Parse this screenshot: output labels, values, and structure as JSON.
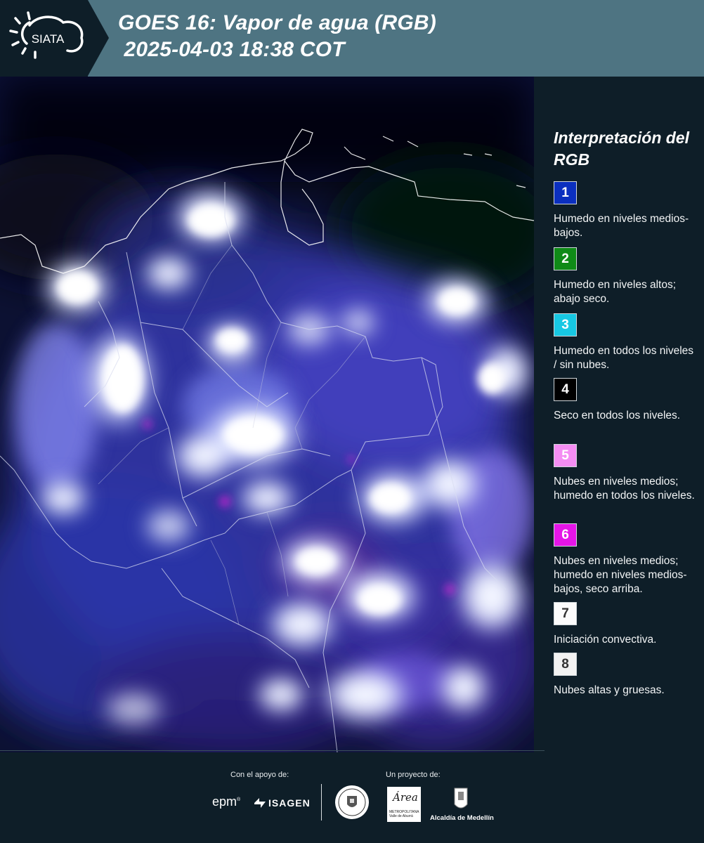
{
  "header": {
    "logo_text": "SIATA",
    "title_line1": "GOES 16: Vapor de agua (RGB)",
    "title_line2": " 2025-04-03 18:38 COT"
  },
  "legend": {
    "title": "Interpretación del RGB",
    "items": [
      {
        "number": "1",
        "color": "#0b2fbf",
        "text_color": "#ffffff",
        "text": "Humedo en niveles medios-bajos."
      },
      {
        "number": "2",
        "color": "#0f8a17",
        "text_color": "#ffffff",
        "text": "Humedo en niveles altos; abajo seco."
      },
      {
        "number": "3",
        "color": "#17c8e3",
        "text_color": "#ffffff",
        "text": "Humedo en todos los niveles / sin nubes."
      },
      {
        "number": "4",
        "color": "#000000",
        "text_color": "#ffffff",
        "text": "Seco en todos los niveles."
      },
      {
        "number": "5",
        "color": "#f48df3",
        "text_color": "#ffffff",
        "text": "Nubes en niveles medios; humedo en todos los niveles."
      },
      {
        "number": "6",
        "color": "#e515e8",
        "text_color": "#ffffff",
        "text": "Nubes en niveles medios; humedo en niveles medios-bajos, seco arriba."
      },
      {
        "number": "7",
        "color": "#fbfbfb",
        "text_color": "#333333",
        "text": "Iniciación convectiva."
      },
      {
        "number": "8",
        "color": "#f2f2f2",
        "text_color": "#333333",
        "text": "Nubes altas y gruesas."
      }
    ]
  },
  "footer": {
    "support_label": "Con el apoyo de:",
    "project_label": "Un proyecto de:",
    "sponsors": [
      "epm",
      "ISAGEN"
    ],
    "area_name": "Área",
    "area_subtitle": "METROPOLITANA Valle de Aburrá",
    "alcaldia": "Alcaldía de Medellín"
  },
  "colors": {
    "background": "#0e1e28",
    "header": "#4e7482"
  }
}
